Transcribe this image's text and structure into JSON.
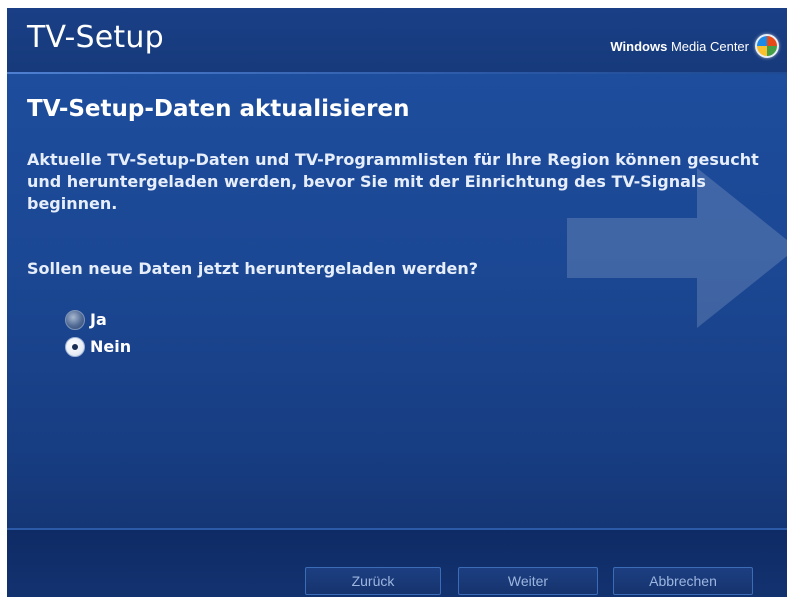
{
  "window": {
    "title": "TV-Setup",
    "brand_bold": "Windows",
    "brand_rest": "Media Center"
  },
  "content": {
    "heading": "TV-Setup-Daten aktualisieren",
    "description": "Aktuelle TV-Setup-Daten und TV-Programmlisten für Ihre Region können gesucht und heruntergeladen werden, bevor Sie mit der Einrichtung des TV-Signals beginnen.",
    "question": "Sollen neue Daten jetzt heruntergeladen werden?",
    "options": [
      {
        "label": "Ja",
        "selected": false
      },
      {
        "label": "Nein",
        "selected": true
      }
    ]
  },
  "footer": {
    "back_label": "Zurück",
    "next_label": "Weiter",
    "cancel_label": "Abbrechen"
  },
  "colors": {
    "background": "#1b4793",
    "title_bar": "#163a7b",
    "footer": "#12326f",
    "button_text": "#9db6e0"
  },
  "icons": [
    "windows-media-center-logo-icon",
    "arrow-watermark-icon",
    "radio-unchecked-icon",
    "radio-checked-icon"
  ]
}
